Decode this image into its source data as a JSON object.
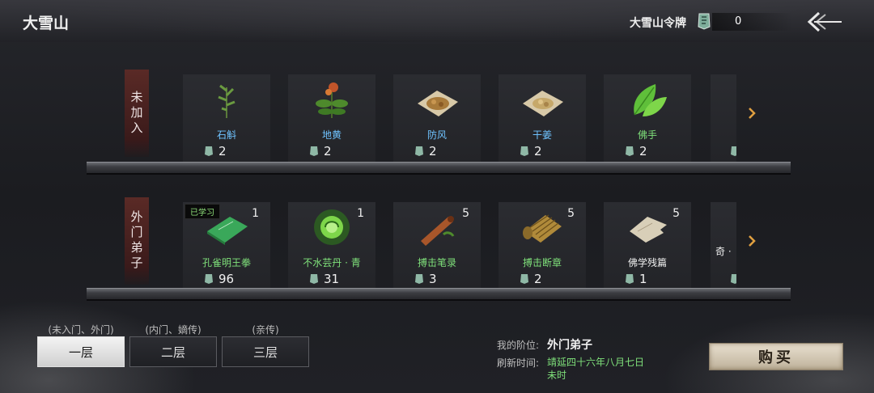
{
  "header": {
    "title": "大雪山",
    "token_label": "大雪山令牌",
    "token_count": "0"
  },
  "rows": [
    {
      "label": "未加入",
      "items": [
        {
          "name": "石斛",
          "price": "2",
          "color": "#6fc3ff",
          "icon": "herb-sprig-icon"
        },
        {
          "name": "地黄",
          "price": "2",
          "color": "#6fc3ff",
          "icon": "herb-flower-icon"
        },
        {
          "name": "防风",
          "price": "2",
          "color": "#6fc3ff",
          "icon": "dried-herb-pile-icon"
        },
        {
          "name": "干姜",
          "price": "2",
          "color": "#6fc3ff",
          "icon": "dried-ginger-pile-icon"
        },
        {
          "name": "佛手",
          "price": "2",
          "color": "#7fe07a",
          "icon": "green-leaves-icon"
        }
      ]
    },
    {
      "label": "外门弟子",
      "items": [
        {
          "name": "孔雀明王拳",
          "price": "96",
          "qty": "1",
          "badge": "已学习",
          "color": "#7fe07a",
          "icon": "green-book-icon"
        },
        {
          "name": "不水芸丹 · 青",
          "price": "31",
          "qty": "1",
          "color": "#7fe07a",
          "icon": "green-pill-orb-icon"
        },
        {
          "name": "搏击笔录",
          "price": "3",
          "qty": "5",
          "color": "#7fe07a",
          "icon": "scroll-roll-icon"
        },
        {
          "name": "搏击断章",
          "price": "2",
          "qty": "5",
          "color": "#7fe07a",
          "icon": "bamboo-scroll-icon"
        },
        {
          "name": "佛学残篇",
          "price": "1",
          "qty": "5",
          "color": "#f0f0f0",
          "icon": "torn-page-icon"
        }
      ],
      "partial_name": "奇 ·"
    }
  ],
  "tabs": [
    {
      "caption": "(未入门、外门)",
      "label": "一层",
      "active": true
    },
    {
      "caption": "(内门、嫡传)",
      "label": "二层",
      "active": false
    },
    {
      "caption": "(亲传)",
      "label": "三层",
      "active": false
    }
  ],
  "info": {
    "rank_label": "我的阶位:",
    "rank_value": "外门弟子",
    "refresh_label": "刷新时间:",
    "refresh_value": "靖延四十六年八月七日未时"
  },
  "buy_label": "购买",
  "colors": {
    "accent_green": "#7fe07a",
    "accent_blue": "#6fc3ff",
    "row_label_bg": "#5a2a26"
  }
}
